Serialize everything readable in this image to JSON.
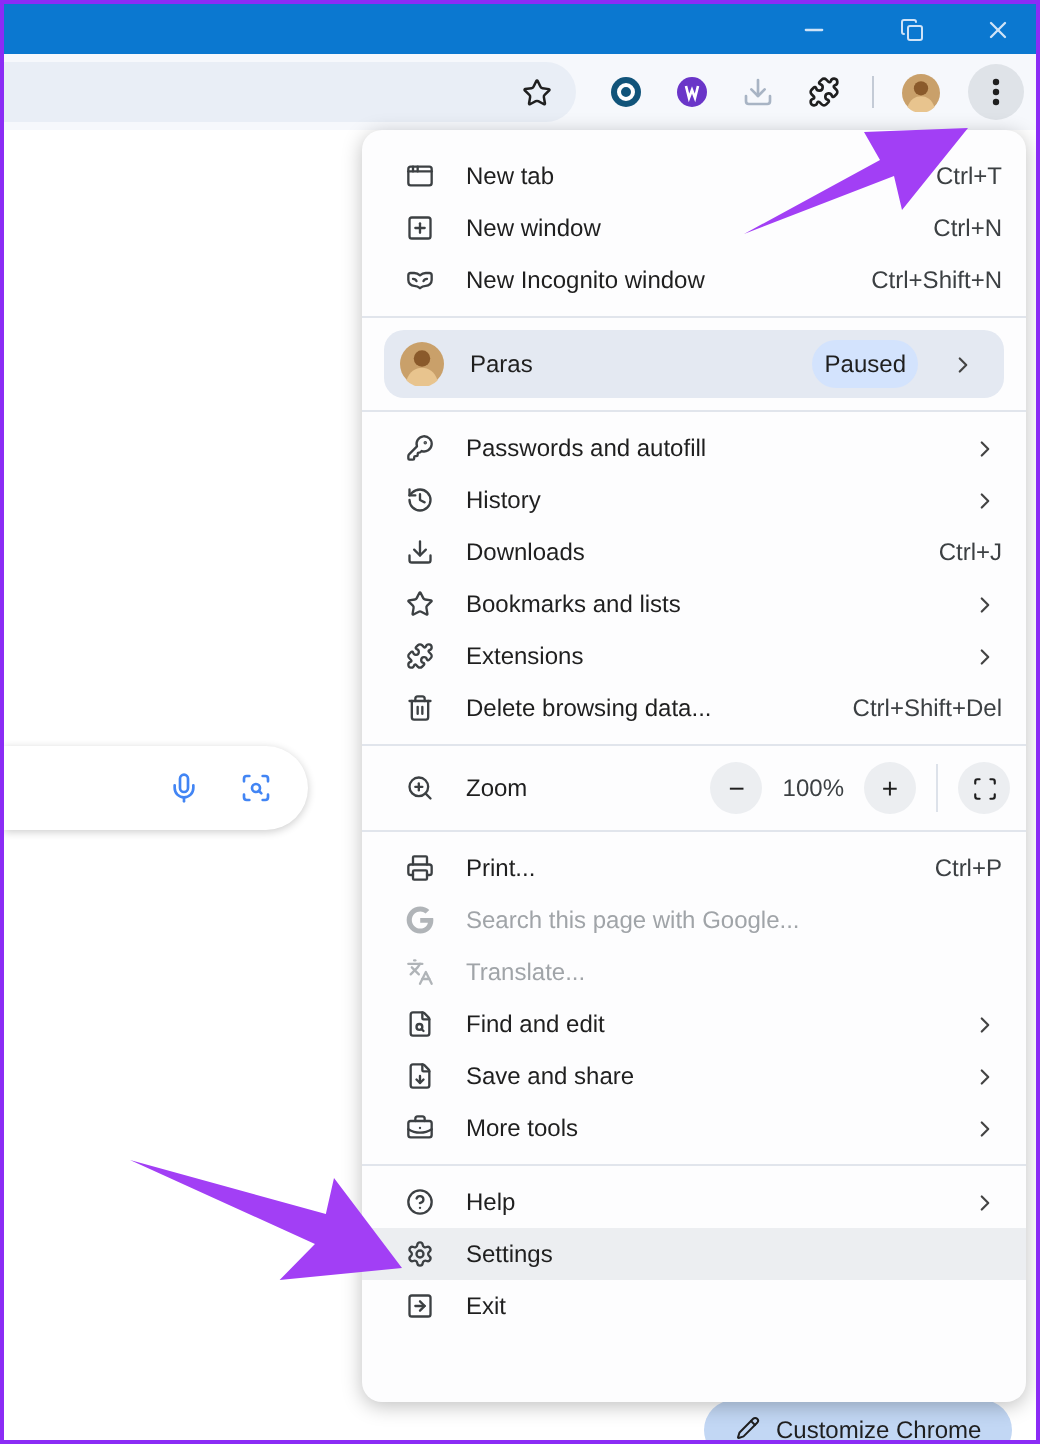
{
  "menu": {
    "sections": [
      {
        "kind": "items",
        "items": [
          {
            "label": "New tab",
            "shortcut": "Ctrl+T",
            "submenu": false,
            "disabled": false,
            "selected": false
          },
          {
            "label": "New window",
            "shortcut": "Ctrl+N",
            "submenu": false,
            "disabled": false,
            "selected": false
          },
          {
            "label": "New Incognito window",
            "shortcut": "Ctrl+Shift+N",
            "submenu": false,
            "disabled": false,
            "selected": false
          }
        ]
      },
      {
        "kind": "profile",
        "name": "Paras",
        "badge": "Paused"
      },
      {
        "kind": "items",
        "items": [
          {
            "label": "Passwords and autofill",
            "submenu": true,
            "disabled": false,
            "selected": false
          },
          {
            "label": "History",
            "submenu": true,
            "disabled": false,
            "selected": false
          },
          {
            "label": "Downloads",
            "shortcut": "Ctrl+J",
            "submenu": false,
            "disabled": false,
            "selected": false
          },
          {
            "label": "Bookmarks and lists",
            "submenu": true,
            "disabled": false,
            "selected": false
          },
          {
            "label": "Extensions",
            "submenu": true,
            "disabled": false,
            "selected": false
          },
          {
            "label": "Delete browsing data...",
            "shortcut": "Ctrl+Shift+Del",
            "submenu": false,
            "disabled": false,
            "selected": false
          }
        ]
      },
      {
        "kind": "zoom",
        "label": "Zoom",
        "value": "100%",
        "minus": "−",
        "plus": "+"
      },
      {
        "kind": "items",
        "items": [
          {
            "label": "Print...",
            "shortcut": "Ctrl+P",
            "submenu": false,
            "disabled": false,
            "selected": false
          },
          {
            "label": "Search this page with Google...",
            "submenu": false,
            "disabled": true,
            "selected": false
          },
          {
            "label": "Translate...",
            "submenu": false,
            "disabled": true,
            "selected": false
          },
          {
            "label": "Find and edit",
            "submenu": true,
            "disabled": false,
            "selected": false
          },
          {
            "label": "Save and share",
            "submenu": true,
            "disabled": false,
            "selected": false
          },
          {
            "label": "More tools",
            "submenu": true,
            "disabled": false,
            "selected": false
          }
        ]
      },
      {
        "kind": "items",
        "items": [
          {
            "label": "Help",
            "submenu": true,
            "disabled": false,
            "selected": false
          },
          {
            "label": "Settings",
            "submenu": false,
            "disabled": false,
            "selected": true
          },
          {
            "label": "Exit",
            "submenu": false,
            "disabled": false,
            "selected": false
          }
        ]
      }
    ]
  },
  "customize_button": {
    "label": "Customize Chrome"
  }
}
